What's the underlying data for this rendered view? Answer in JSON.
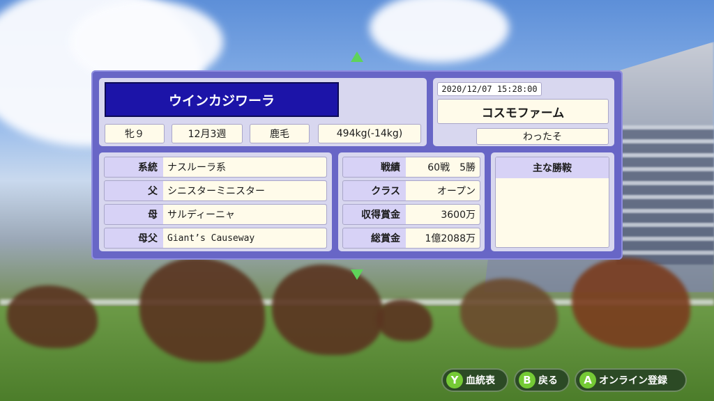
{
  "horse": {
    "name": "ウインカジワーラ",
    "sex_age": "牝９",
    "birth": "12月3週",
    "coat": "鹿毛",
    "weight": "494kg(-14kg)"
  },
  "owner": {
    "timestamp": "2020/12/07 15:28:00",
    "farm": "コスモファーム",
    "user": "わったそ"
  },
  "pedigree": [
    {
      "label": "系統",
      "value": "ナスルーラ系"
    },
    {
      "label": "父",
      "value": "シニスターミニスター"
    },
    {
      "label": "母",
      "value": "サルディーニャ"
    },
    {
      "label": "母父",
      "value": "Giant’s Causeway"
    }
  ],
  "record": [
    {
      "label": "戦績",
      "value": "60戦　5勝"
    },
    {
      "label": "クラス",
      "value": "オープン"
    },
    {
      "label": "収得賞金",
      "value": "3600万"
    },
    {
      "label": "総賞金",
      "value": "1億2088万"
    }
  ],
  "wins": {
    "header": "主な勝鞍"
  },
  "buttons": [
    {
      "key": "Y",
      "label": "血統表"
    },
    {
      "key": "B",
      "label": "戻る"
    },
    {
      "key": "A",
      "label": "オンライン登録"
    }
  ]
}
